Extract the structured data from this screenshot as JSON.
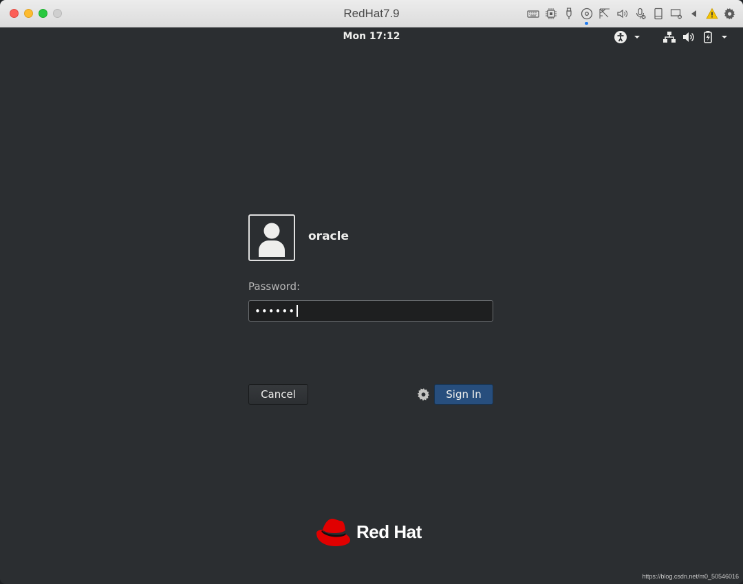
{
  "window": {
    "title": "RedHat7.9"
  },
  "vm_toolbar": {
    "icons": [
      "keyboard-icon",
      "cpu-icon",
      "usb-icon",
      "optical-disc-icon",
      "network-icon",
      "audio-icon",
      "microphone-icon",
      "hard-disk-icon",
      "display-icon",
      "back-arrow-icon",
      "warning-icon",
      "settings-gear-icon"
    ]
  },
  "top_bar": {
    "clock": "Mon 17:12",
    "icons": [
      "accessibility-icon",
      "network-wired-icon",
      "volume-icon",
      "battery-icon"
    ]
  },
  "login": {
    "username": "oracle",
    "password_label": "Password:",
    "password_value": "••••••",
    "cancel_label": "Cancel",
    "signin_label": "Sign In"
  },
  "branding": {
    "logo_text": "Red Hat"
  },
  "watermark": "https://blog.csdn.net/m0_50546016",
  "colors": {
    "background": "#2b2e31",
    "signin": "#274e7d",
    "redhat_red": "#e00000",
    "warning": "#f5c400"
  }
}
